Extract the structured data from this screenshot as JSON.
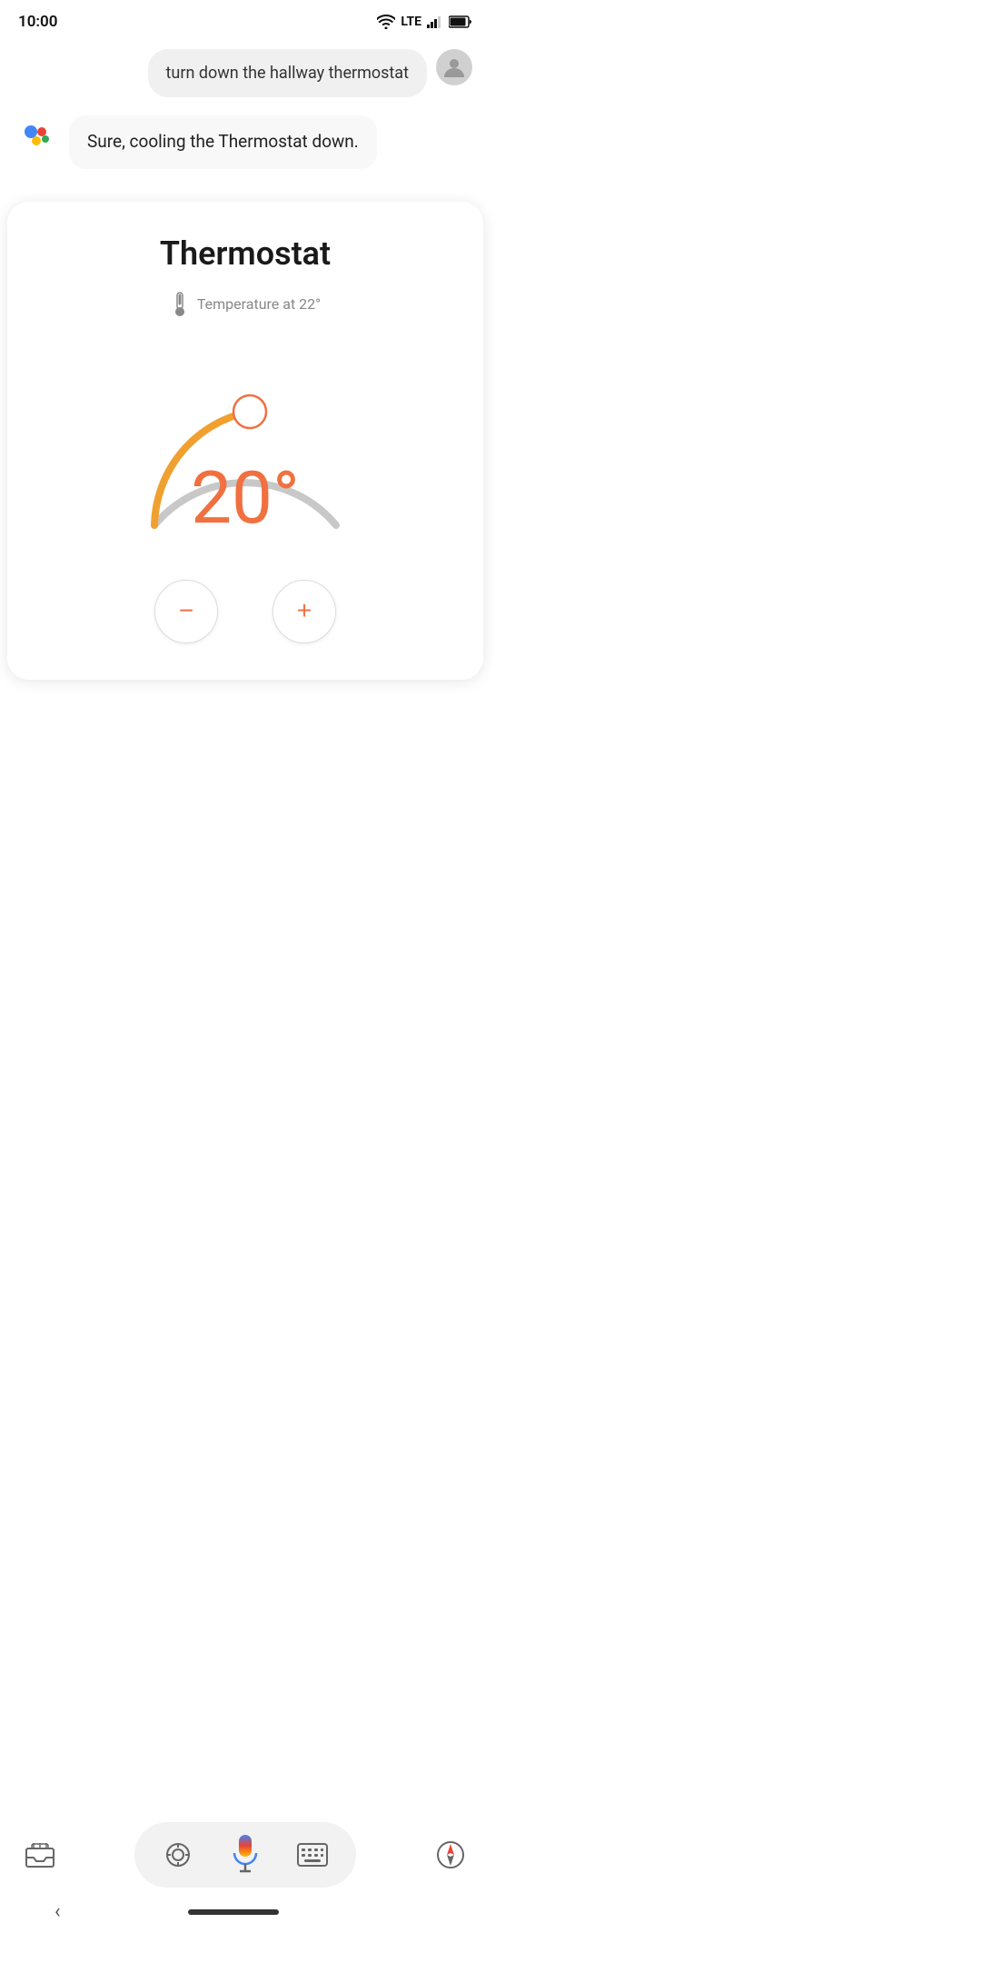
{
  "statusBar": {
    "time": "10:00",
    "lte": "LTE"
  },
  "chat": {
    "userMessage": "turn down the hallway thermostat",
    "assistantMessage": "Sure, cooling the Thermostat down."
  },
  "thermostat": {
    "title": "Thermostat",
    "tempLabel": "Temperature at 22°",
    "currentTemp": "20°",
    "minusLabel": "−",
    "plusLabel": "+"
  },
  "toolbar": {
    "cameraIcon": "camera",
    "micIcon": "mic",
    "keyboardIcon": "keyboard",
    "compassIcon": "compass",
    "assistIcon": "assistant"
  },
  "colors": {
    "orange": "#f07040",
    "arcActive": "#f0a030",
    "arcInactive": "#c8c8c8",
    "dialHandle": "#f07040"
  }
}
